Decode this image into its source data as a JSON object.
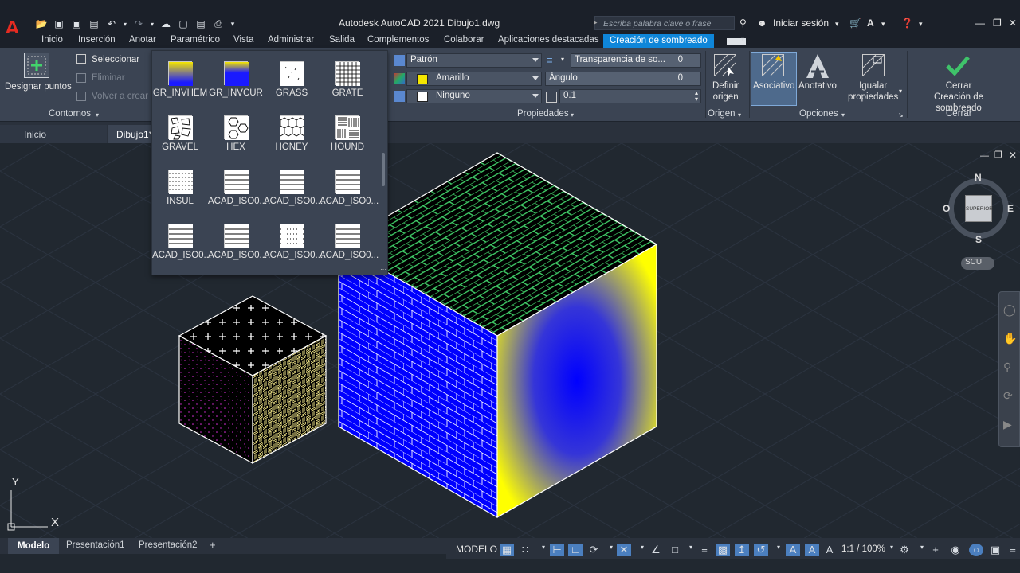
{
  "window": {
    "app_logo": "A",
    "title": "Autodesk AutoCAD 2021    Dibujo1.dwg",
    "search_placeholder": "Escriba palabra clave o frase",
    "sign_in": "Iniciar sesión"
  },
  "ribbon_tabs": [
    "Inicio",
    "Inserción",
    "Anotar",
    "Paramétrico",
    "Vista",
    "Administrar",
    "Salida",
    "Complementos",
    "Colaborar",
    "Aplicaciones destacadas",
    "Creación de sombreado"
  ],
  "ribbon": {
    "contornos": {
      "title": "Contornos",
      "designar": "Designar puntos",
      "seleccionar": "Seleccionar",
      "eliminar": "Eliminar",
      "volver": "Volver a crear"
    },
    "propiedades": {
      "title": "Propiedades",
      "tipo": "Patrón",
      "color": "Amarillo",
      "fondo": "Ninguno",
      "transparencia_label": "Transparencia de so...",
      "transparencia_value": "0",
      "angulo_label": "Ángulo",
      "angulo_value": "0",
      "escala_value": "0.1"
    },
    "origen": {
      "title": "Origen",
      "definir": "Definir",
      "origen": "origen"
    },
    "opciones": {
      "title": "Opciones",
      "asociativo": "Asociativo",
      "anotativo": "Anotativo",
      "igualar1": "Igualar",
      "igualar2": "propiedades"
    },
    "cerrar": {
      "title": "Cerrar",
      "cerrar1": "Cerrar",
      "cerrar2": "Creación de sombreado"
    }
  },
  "hatch_patterns": [
    {
      "name": "GR_INVHEM",
      "kind": "grad_yb"
    },
    {
      "name": "GR_INVCUR",
      "kind": "grad_by"
    },
    {
      "name": "GRASS",
      "kind": "grass"
    },
    {
      "name": "GRATE",
      "kind": "grate"
    },
    {
      "name": "GRAVEL",
      "kind": "gravel"
    },
    {
      "name": "HEX",
      "kind": "hex"
    },
    {
      "name": "HONEY",
      "kind": "honey"
    },
    {
      "name": "HOUND",
      "kind": "hound"
    },
    {
      "name": "INSUL",
      "kind": "insul"
    },
    {
      "name": "ACAD_ISO0...",
      "kind": "lines"
    },
    {
      "name": "ACAD_ISO0...",
      "kind": "lines"
    },
    {
      "name": "ACAD_ISO0...",
      "kind": "lines"
    },
    {
      "name": "ACAD_ISO0...",
      "kind": "lines"
    },
    {
      "name": "ACAD_ISO0...",
      "kind": "lines"
    },
    {
      "name": "ACAD_ISO0...",
      "kind": "dots"
    },
    {
      "name": "ACAD_ISO0...",
      "kind": "lines"
    }
  ],
  "doc_tabs": {
    "inicio": "Inicio",
    "dibujo": "Dibujo1*"
  },
  "viewcube": {
    "n": "N",
    "s": "S",
    "e": "E",
    "o": "O",
    "face": "SUPERIOR",
    "wcs": "SCU"
  },
  "ucs": {
    "x": "X",
    "y": "Y"
  },
  "layout_tabs": [
    "Modelo",
    "Presentación1",
    "Presentación2"
  ],
  "status": {
    "modelo": "MODELO",
    "scale": "1:1 / 100%"
  },
  "colors": {
    "accent": "#0f86d9",
    "logo": "#e52b21",
    "grid": "#2b3340"
  }
}
